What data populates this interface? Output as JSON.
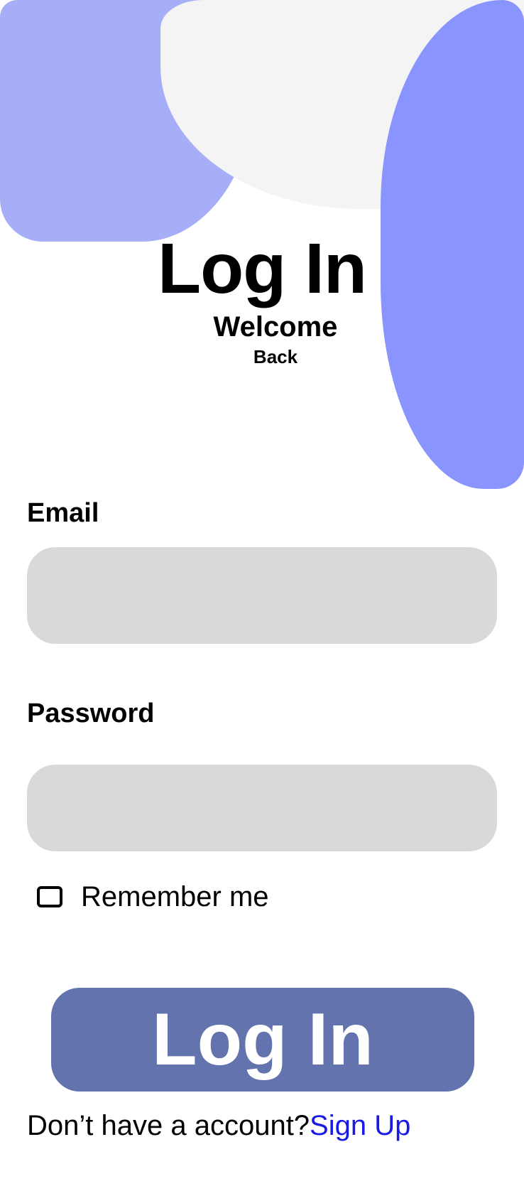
{
  "header": {
    "title": "Log In",
    "subtitle": "Welcome",
    "subtitle_small": "Back"
  },
  "form": {
    "email": {
      "label": "Email",
      "value": "",
      "placeholder": ""
    },
    "password": {
      "label": "Password",
      "value": "",
      "placeholder": ""
    },
    "remember": {
      "label": "Remember me",
      "checked": false
    },
    "submit_label": "Log In"
  },
  "footer": {
    "prompt": "Don’t have a account?",
    "signup_label": "Sign Up"
  },
  "colors": {
    "accent_button": "#6373ae",
    "link": "#1a1ae6",
    "shape_left": "#a6aef7",
    "shape_right": "#8591ff",
    "shape_gray": "#f4f4f4",
    "input_background": "#d9d9d9"
  }
}
